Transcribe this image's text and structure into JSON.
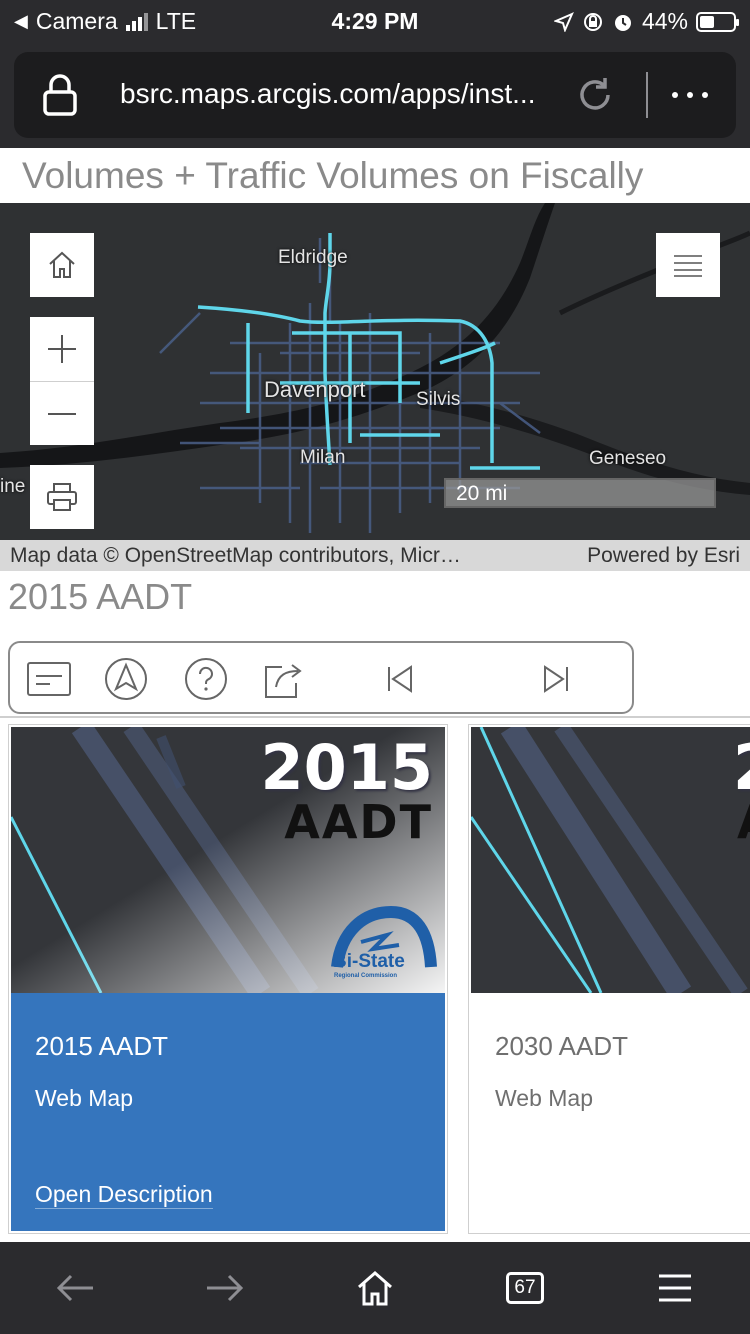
{
  "status_bar": {
    "back_app": "Camera",
    "network": "LTE",
    "time": "4:29 PM",
    "battery": "44%"
  },
  "browser": {
    "url": "bsrc.maps.arcgis.com/apps/inst...",
    "lock_icon": "lock-icon",
    "reload_icon": "reload-icon",
    "more_icon": "more-icon"
  },
  "page": {
    "title": "Volumes + Traffic Volumes on Fiscally"
  },
  "map": {
    "labels": {
      "eldridge": "Eldridge",
      "davenport": "Davenport",
      "silvis": "Silvis",
      "milan": "Milan",
      "geneseo": "Geneseo",
      "edge": "ine"
    },
    "scale": "20 mi",
    "attribution": "Map data © OpenStreetMap contributors, Micr…",
    "powered_by": "Powered by Esri",
    "colors": {
      "road_highlight": "#5fd6ea",
      "road_dim": "#4a5f88",
      "river": "#151618"
    }
  },
  "section": {
    "title": "2015 AADT"
  },
  "toolbar": {
    "items": [
      "details-icon",
      "locate-icon",
      "help-icon",
      "share-icon",
      "previous-icon",
      "next-icon"
    ]
  },
  "cards": [
    {
      "thumb_year": "2015",
      "thumb_sub": "AADT",
      "logo": "Bi-State",
      "logo_sub": "Regional Commission",
      "title": "2015 AADT",
      "type": "Web Map",
      "link": "Open Description",
      "accent": "#3575bd"
    },
    {
      "thumb_year": "2",
      "thumb_sub": "A",
      "title": "2030 AADT",
      "type": "Web Map"
    }
  ],
  "bottom_bar": {
    "tabs_count": "67"
  }
}
